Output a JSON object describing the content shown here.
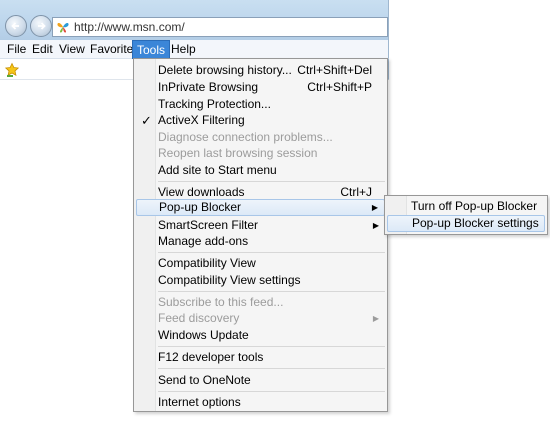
{
  "address": {
    "url": "http://www.msn.com/"
  },
  "menubar": {
    "items": [
      "File",
      "Edit",
      "View",
      "Favorites",
      "Tools",
      "Help"
    ],
    "active": "Tools"
  },
  "tools_menu": {
    "items": [
      {
        "label": "Delete browsing history...",
        "shortcut": "Ctrl+Shift+Del"
      },
      {
        "label": "InPrivate Browsing",
        "shortcut": "Ctrl+Shift+P"
      },
      {
        "label": "Tracking Protection..."
      },
      {
        "label": "ActiveX Filtering",
        "checked": true
      },
      {
        "label": "Diagnose connection problems...",
        "disabled": true
      },
      {
        "label": "Reopen last browsing session",
        "disabled": true
      },
      {
        "label": "Add site to Start menu"
      },
      {
        "label": "View downloads",
        "shortcut": "Ctrl+J"
      },
      {
        "label": "Pop-up Blocker",
        "has_submenu": true,
        "highlighted": true
      },
      {
        "label": "SmartScreen Filter",
        "has_submenu": true
      },
      {
        "label": "Manage add-ons"
      },
      {
        "label": "Compatibility View"
      },
      {
        "label": "Compatibility View settings"
      },
      {
        "label": "Subscribe to this feed...",
        "disabled": true
      },
      {
        "label": "Feed discovery",
        "disabled": true,
        "has_submenu": true
      },
      {
        "label": "Windows Update"
      },
      {
        "label": "F12 developer tools"
      },
      {
        "label": "Send to OneNote"
      },
      {
        "label": "Internet options"
      }
    ]
  },
  "popup_submenu": {
    "items": [
      {
        "label": "Turn off Pop-up Blocker"
      },
      {
        "label": "Pop-up Blocker settings",
        "highlighted": true
      }
    ]
  },
  "icons": {
    "back": "back-arrow-icon",
    "forward": "forward-arrow-icon",
    "site": "msn-butterfly-icon",
    "favorites": "favorites-star-icon",
    "check": "checkmark-icon",
    "submenu": "submenu-arrow-icon"
  },
  "colors": {
    "menu_active": "#3b86d8",
    "menu_highlight": "#dce9f7",
    "disabled_text": "#9c9c9c"
  }
}
